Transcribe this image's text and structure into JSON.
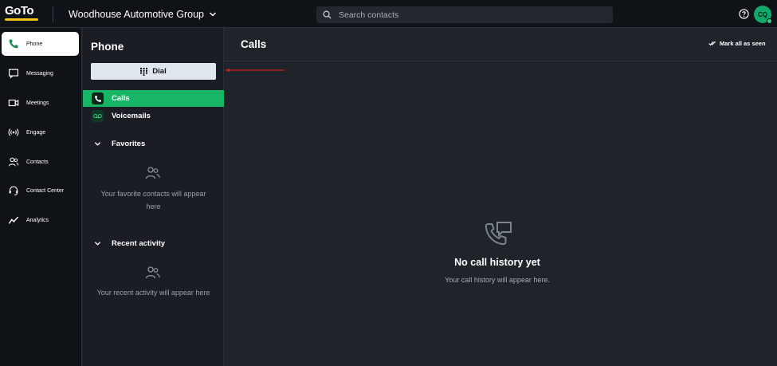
{
  "brand": {
    "logo_text": "GoTo",
    "accent": "#f5c518",
    "green": "#18b566"
  },
  "header": {
    "org_name": "Woodhouse Automotive Group",
    "search_placeholder": "Search contacts",
    "avatar_initials": "CQ"
  },
  "nav": {
    "items": [
      {
        "label": "Phone",
        "icon": "phone-icon",
        "active": true
      },
      {
        "label": "Messaging",
        "icon": "message-icon"
      },
      {
        "label": "Meetings",
        "icon": "video-icon"
      },
      {
        "label": "Engage",
        "icon": "broadcast-icon"
      },
      {
        "label": "Contacts",
        "icon": "contacts-icon"
      },
      {
        "label": "Contact Center",
        "icon": "headset-icon"
      },
      {
        "label": "Analytics",
        "icon": "analytics-icon"
      }
    ]
  },
  "panel": {
    "title": "Phone",
    "dial_label": "Dial",
    "calls_label": "Calls",
    "voicemails_label": "Voicemails",
    "favorites_label": "Favorites",
    "favorites_empty_line1": "Your favorite contacts will appear",
    "favorites_empty_line2": "here",
    "recent_label": "Recent activity",
    "recent_empty": "Your recent activity will appear here"
  },
  "main": {
    "title": "Calls",
    "mark_all_label": "Mark all as seen",
    "empty_title": "No call history yet",
    "empty_sub": "Your call history will appear here."
  }
}
